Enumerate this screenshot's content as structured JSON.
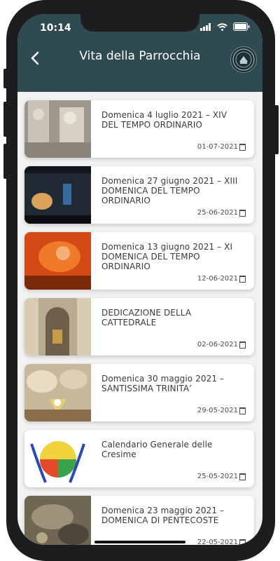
{
  "status": {
    "time": "10:14"
  },
  "header": {
    "title": "Vita della Parrocchia",
    "back_icon": "chevron-left-icon",
    "logo_icon": "parish-seal-icon"
  },
  "posts": [
    {
      "title": "Domenica 4 luglio 2021 – XIV DEL TEMPO ORDINARIO",
      "date": "01-07-2021",
      "thumb": "marble-sculpture"
    },
    {
      "title": "Domenica 27 giugno 2021 – XIII DOMENICA DEL TEMPO ORDINARIO",
      "date": "25-06-2021",
      "thumb": "night-scene"
    },
    {
      "title": "Domenica 13 giugno 2021 – XI DOMENICA DEL TEMPO ORDINARIO",
      "date": "12-06-2021",
      "thumb": "orange-painting"
    },
    {
      "title": "DEDICAZIONE DELLA CATTEDRALE",
      "date": "02-06-2021",
      "thumb": "cathedral-interior"
    },
    {
      "title": "Domenica 30 maggio 2021 – SANTISSIMA TRINITA’",
      "date": "29-05-2021",
      "thumb": "trinity-fresco"
    },
    {
      "title": "Calendario Generale delle Cresime",
      "date": "25-05-2021",
      "thumb": "confirmation-logo"
    },
    {
      "title": "Domenica 23 maggio 2021 – DOMENICA DI PENTECOSTE",
      "date": "22-05-2021",
      "thumb": "pentecost-painting"
    }
  ],
  "colors": {
    "appbar": "#2f4a50",
    "background": "#f2f2f2",
    "card": "#ffffff"
  }
}
